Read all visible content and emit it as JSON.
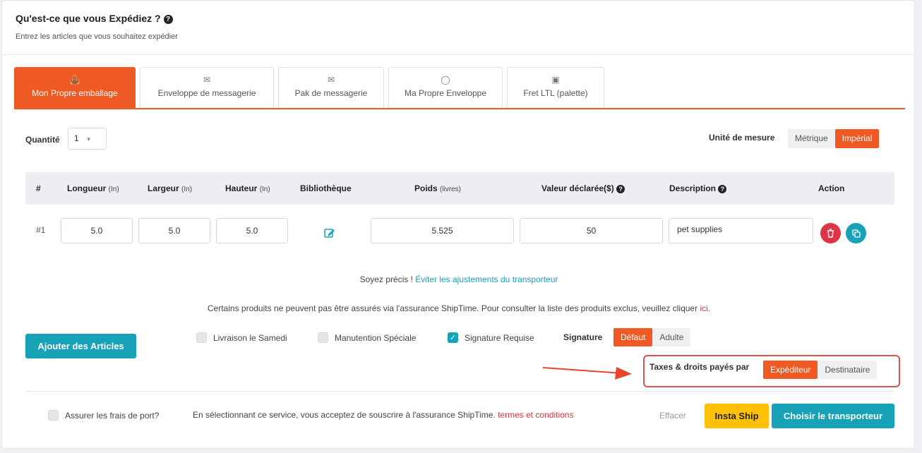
{
  "header": {
    "title": "Qu'est-ce que vous Expédiez ?",
    "subtitle": "Entrez les articles que vous souhaitez expédier"
  },
  "tabs": [
    {
      "label": "Mon Propre emballage",
      "icon": "shopping-bag-icon",
      "active": true
    },
    {
      "label": "Enveloppe de messagerie",
      "icon": "envelope-outline-icon",
      "active": false
    },
    {
      "label": "Pak de messagerie",
      "icon": "envelope-solid-icon",
      "active": false
    },
    {
      "label": "Ma Propre Enveloppe",
      "icon": "envelope-open-icon",
      "active": false
    },
    {
      "label": "Fret LTL (palette)",
      "icon": "cubes-icon",
      "active": false
    }
  ],
  "quantity": {
    "label": "Quantité",
    "value": "1"
  },
  "units": {
    "label": "Unité de mesure",
    "options": [
      "Métrique",
      "Impérial"
    ],
    "selected": "Impérial"
  },
  "table": {
    "headers": {
      "num": "#",
      "length": "Longueur",
      "length_unit": "(In)",
      "width": "Largeur",
      "width_unit": "(In)",
      "height": "Hauteur",
      "height_unit": "(In)",
      "library": "Bibliothèque",
      "weight": "Poids",
      "weight_unit": "(livres)",
      "declared": "Valeur déclarée($)",
      "description": "Description",
      "action": "Action"
    },
    "rows": [
      {
        "num": "#1",
        "length": "5.0",
        "width": "5.0",
        "height": "5.0",
        "weight": "5.525",
        "declared": "50",
        "description": "pet supplies"
      }
    ]
  },
  "notes": {
    "precise_prefix": "Soyez précis !",
    "precise_link": "Éviter les ajustements du transporteur",
    "insurance_text": "Certains produits ne peuvent pas être assurés via l'assurance ShipTime. Pour consulter la liste des produits exclus, veuillez cliquer",
    "insurance_link": "ici."
  },
  "add_button": "Ajouter des Articles",
  "options": {
    "saturday": {
      "label": "Livraison le Samedi",
      "checked": false
    },
    "special": {
      "label": "Manutention Spéciale",
      "checked": false
    },
    "signature_required": {
      "label": "Signature Requise",
      "checked": true
    },
    "signature_label": "Signature",
    "signature_options": [
      "Défaut",
      "Adulte"
    ],
    "signature_selected": "Défaut"
  },
  "duties": {
    "label": "Taxes & droits payés par",
    "options": [
      "Expéditeur",
      "Destinataire"
    ],
    "selected": "Expéditeur"
  },
  "footer": {
    "insure_label": "Assurer les frais de port?",
    "insure_text": "En sélectionnant ce service, vous acceptez de souscrire à l'assurance ShipTime.",
    "terms_link": "termes et conditions",
    "clear": "Effacer",
    "insta_ship": "Insta Ship",
    "choose_carrier": "Choisir le transporteur"
  },
  "colors": {
    "accent": "#ef5a24",
    "teal": "#17a2b8",
    "danger": "#dc3545",
    "warning": "#ffc107"
  }
}
